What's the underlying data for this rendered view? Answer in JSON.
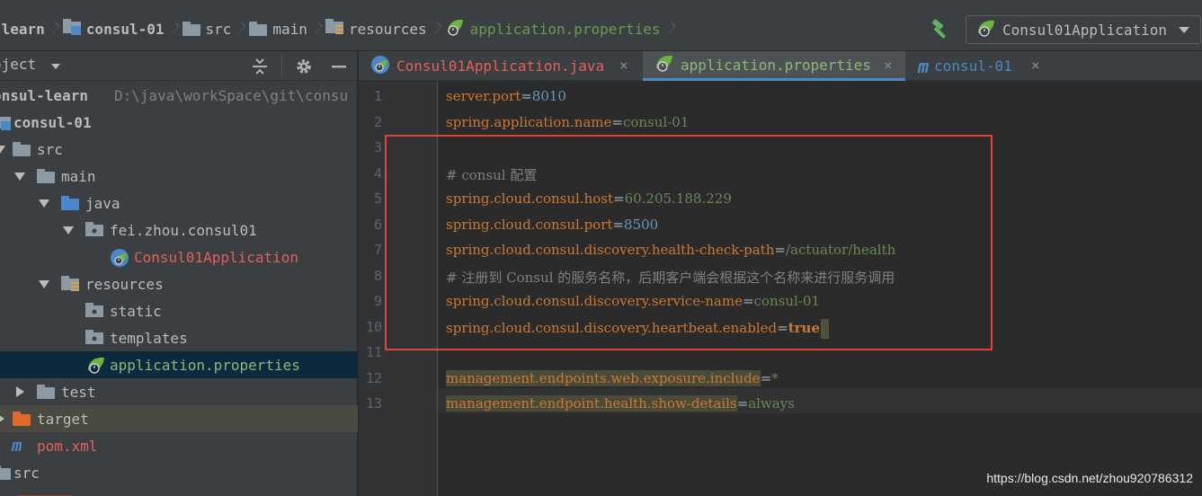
{
  "breadcrumb": {
    "items": [
      {
        "label": "-learn",
        "icon": "module-icon"
      },
      {
        "label": "consul-01",
        "icon": "module-folder-icon"
      },
      {
        "label": "src",
        "icon": "folder-icon"
      },
      {
        "label": "main",
        "icon": "folder-icon"
      },
      {
        "label": "resources",
        "icon": "resources-folder-icon"
      },
      {
        "label": "application.properties",
        "icon": "spring-leaf-icon"
      }
    ]
  },
  "toolbar": {
    "build_icon": "hammer-icon",
    "run_config": "Consul01Application"
  },
  "project_panel": {
    "title": "oject",
    "tree": [
      {
        "label": "onsul-learn",
        "path": "D:\\java\\workSpace\\git\\consu"
      },
      {
        "label": "consul-01"
      },
      {
        "label": "src"
      },
      {
        "label": "main"
      },
      {
        "label": "java"
      },
      {
        "label": "fei.zhou.consul01"
      },
      {
        "label": "Consul01Application"
      },
      {
        "label": "resources"
      },
      {
        "label": "static"
      },
      {
        "label": "templates"
      },
      {
        "label": "application.properties"
      },
      {
        "label": "test"
      },
      {
        "label": "target"
      },
      {
        "label": "pom.xml"
      },
      {
        "label": "src"
      }
    ]
  },
  "tabs": [
    {
      "label": "Consul01Application.java",
      "icon": "spring-class-icon"
    },
    {
      "label": "application.properties",
      "icon": "spring-leaf-icon",
      "active": true
    },
    {
      "label": "consul-01",
      "icon": "maven-icon"
    }
  ],
  "editor": {
    "line_numbers": [
      "1",
      "2",
      "3",
      "4",
      "5",
      "6",
      "7",
      "8",
      "9",
      "10",
      "11",
      "12",
      "13"
    ],
    "lines": [
      {
        "key": "server.port",
        "eq": "=",
        "value": "8010"
      },
      {
        "key": "spring.application.name",
        "eq": "=",
        "value": "consul-01"
      },
      {
        "comment": ""
      },
      {
        "comment": "# consul 配置"
      },
      {
        "key": "spring.cloud.consul.host",
        "eq": "=",
        "value": "60.205.188.229"
      },
      {
        "key": "spring.cloud.consul.port",
        "eq": "=",
        "value": "8500"
      },
      {
        "key": "spring.cloud.consul.discovery.health-check-path",
        "eq": "=",
        "value": "/actuator/health"
      },
      {
        "comment": "# 注册到 Consul 的服务名称，后期客户端会根据这个名称来进行服务调用"
      },
      {
        "key": "spring.cloud.consul.discovery.service-name",
        "eq": "=",
        "value": "consul-01"
      },
      {
        "key": "spring.cloud.consul.discovery.heartbeat.enabled",
        "eq": "=",
        "value": "true"
      },
      {
        "comment": ""
      },
      {
        "key": "management.endpoints.web.exposure.include",
        "eq": "=",
        "value": "*"
      },
      {
        "key": "management.endpoint.health.show-details",
        "eq": "=",
        "value": "always"
      }
    ]
  },
  "watermark": "https://blog.csdn.net/zhou920786312",
  "colors": {
    "key": "#cc7832",
    "value": "#6a8759",
    "number": "#6897bb",
    "comment": "#808080",
    "annotation_box": "#e0453d",
    "selection": "#0d293e"
  }
}
